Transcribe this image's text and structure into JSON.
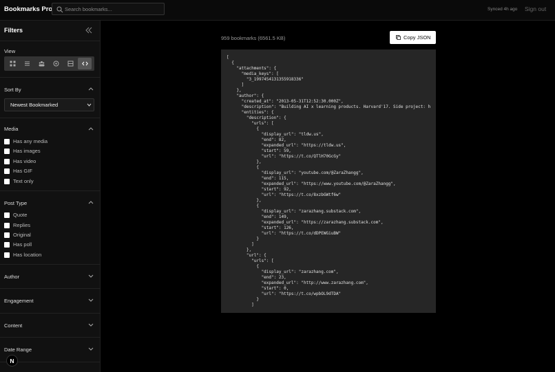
{
  "app": {
    "title": "Bookmarks Pro"
  },
  "search": {
    "placeholder": "Search bookmarks..."
  },
  "header": {
    "synced": "Synced 4h ago",
    "signout": "Sign out"
  },
  "sidebar": {
    "title": "Filters",
    "view": {
      "label": "View",
      "modes": [
        "grid-icon",
        "list-icon",
        "groups-icon",
        "gallery-icon",
        "compact-icon",
        "code-icon"
      ],
      "active": "code-icon"
    },
    "sort": {
      "label": "Sort By",
      "selected": "Newest Bookmarked"
    },
    "media": {
      "label": "Media",
      "options": [
        "Has any media",
        "Has images",
        "Has video",
        "Has GIF",
        "Text only"
      ]
    },
    "post_type": {
      "label": "Post Type",
      "options": [
        "Quote",
        "Replies",
        "Original",
        "Has poll",
        "Has location"
      ]
    },
    "author": {
      "label": "Author"
    },
    "engagement": {
      "label": "Engagement"
    },
    "content": {
      "label": "Content"
    },
    "date_range": {
      "label": "Date Range"
    },
    "badge": "N"
  },
  "main": {
    "count": "959 bookmarks (6561.5 KB)",
    "copy_label": "Copy JSON",
    "json_text": "[\n  {\n    \"attachments\": {\n      \"media_keys\": [\n        \"3_1997454131355918336\"\n      ]\n    },\n    \"author\": {\n      \"created_at\": \"2013-05-31T12:52:30.000Z\",\n      \"description\": \"Building AI x learning products. Harvard'17. Side project: h\n      \"entities\": {\n        \"description\": {\n          \"urls\": [\n            {\n              \"display_url\": \"tldw.us\",\n              \"end\": 82,\n              \"expanded_url\": \"https://tldw.us\",\n              \"start\": 59,\n              \"url\": \"https://t.co/QTlH70GcGy\"\n            },\n            {\n              \"display_url\": \"youtube.com/@ZaraZhangg\",\n              \"end\": 115,\n              \"expanded_url\": \"https://www.youtube.com/@ZaraZhangg\",\n              \"start\": 92,\n              \"url\": \"https://t.co/8xzbGWtf6w\"\n            },\n            {\n              \"display_url\": \"zarazhang.substack.com\",\n              \"end\": 149,\n              \"expanded_url\": \"https://zarazhang.substack.com\",\n              \"start\": 126,\n              \"url\": \"https://t.co/dDPEWGiuBW\"\n            }\n          ]\n        },\n        \"url\": {\n          \"urls\": [\n            {\n              \"display_url\": \"zarazhang.com\",\n              \"end\": 23,\n              \"expanded_url\": \"http://www.zarazhang.com\",\n              \"start\": 0,\n              \"url\": \"https://t.co/wpbOL9dTDA\"\n            }\n          ]"
  }
}
